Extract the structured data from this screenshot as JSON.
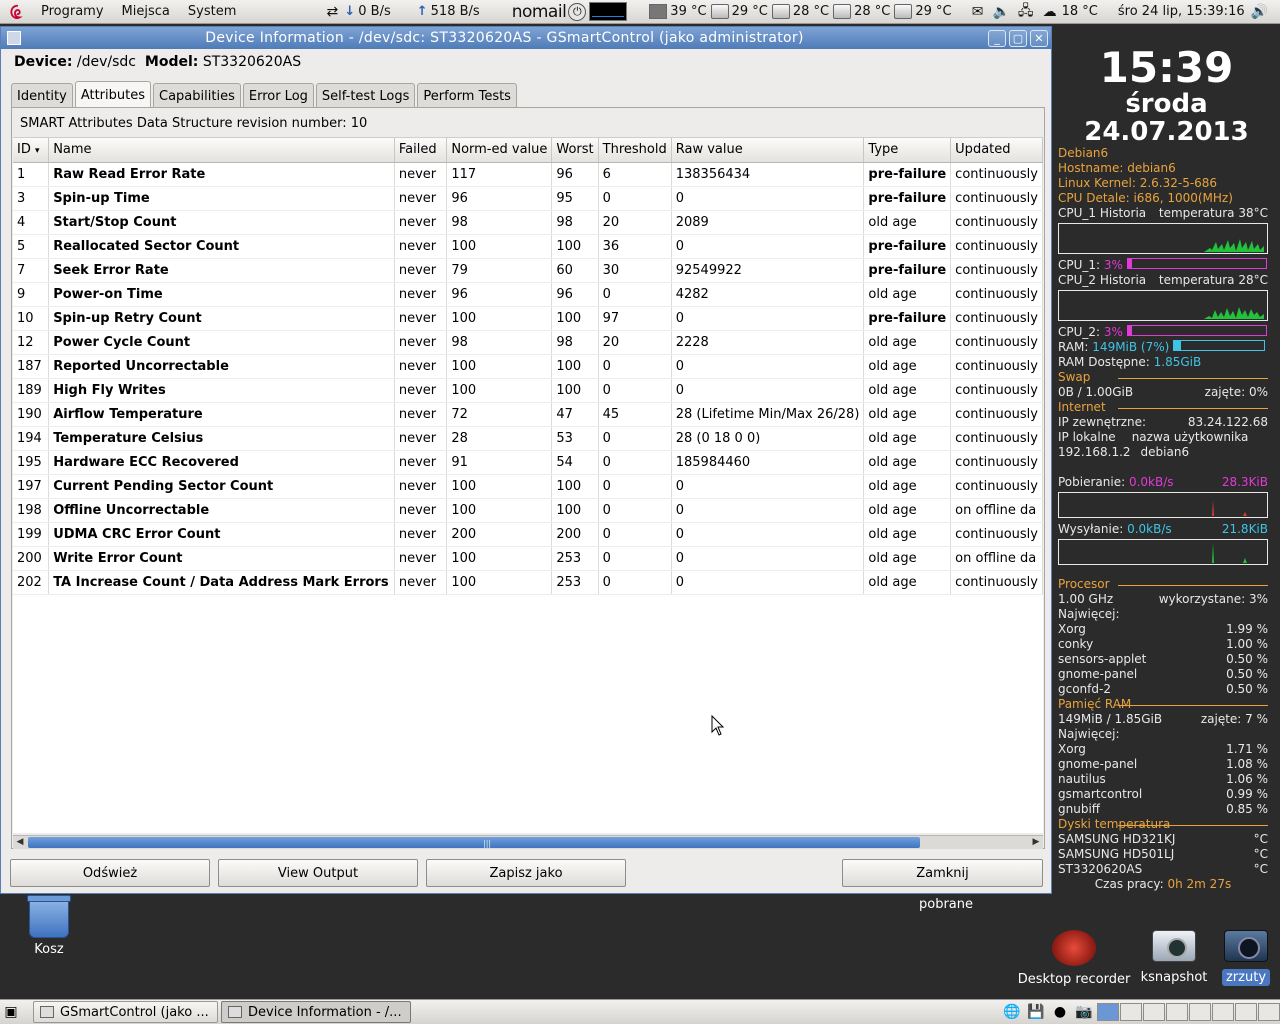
{
  "top_panel": {
    "menus": [
      "Programy",
      "Miejsca",
      "System"
    ],
    "net_down": "0 B/s",
    "net_up": "518 B/s",
    "nomail": "nomail",
    "temps": [
      "39 °C",
      "29 °C",
      "28 °C",
      "28 °C",
      "29 °C"
    ],
    "weather": "18 °C",
    "datetime": "śro 24 lip, 15:39:16"
  },
  "window": {
    "title": "Device Information - /dev/sdc: ST3320620AS - GSmartControl (jako administrator)",
    "device_label": "Device:",
    "device_value": "/dev/sdc",
    "model_label": "Model:",
    "model_value": "ST3320620AS",
    "tabs": [
      "Identity",
      "Attributes",
      "Capabilities",
      "Error Log",
      "Self-test Logs",
      "Perform Tests"
    ],
    "revision": "SMART Attributes Data Structure revision number: 10",
    "columns": [
      "ID",
      "Name",
      "Failed",
      "Norm-ed value",
      "Worst",
      "Threshold",
      "Raw value",
      "Type",
      "Updated"
    ],
    "rows": [
      [
        "1",
        "Raw Read Error Rate",
        "never",
        "117",
        "96",
        "6",
        "138356434",
        "pre-failure",
        "continuously"
      ],
      [
        "3",
        "Spin-up Time",
        "never",
        "96",
        "95",
        "0",
        "0",
        "pre-failure",
        "continuously"
      ],
      [
        "4",
        "Start/Stop Count",
        "never",
        "98",
        "98",
        "20",
        "2089",
        "old age",
        "continuously"
      ],
      [
        "5",
        "Reallocated Sector Count",
        "never",
        "100",
        "100",
        "36",
        "0",
        "pre-failure",
        "continuously"
      ],
      [
        "7",
        "Seek Error Rate",
        "never",
        "79",
        "60",
        "30",
        "92549922",
        "pre-failure",
        "continuously"
      ],
      [
        "9",
        "Power-on Time",
        "never",
        "96",
        "96",
        "0",
        "4282",
        "old age",
        "continuously"
      ],
      [
        "10",
        "Spin-up Retry Count",
        "never",
        "100",
        "100",
        "97",
        "0",
        "pre-failure",
        "continuously"
      ],
      [
        "12",
        "Power Cycle Count",
        "never",
        "98",
        "98",
        "20",
        "2228",
        "old age",
        "continuously"
      ],
      [
        "187",
        "Reported Uncorrectable",
        "never",
        "100",
        "100",
        "0",
        "0",
        "old age",
        "continuously"
      ],
      [
        "189",
        "High Fly Writes",
        "never",
        "100",
        "100",
        "0",
        "0",
        "old age",
        "continuously"
      ],
      [
        "190",
        "Airflow Temperature",
        "never",
        "72",
        "47",
        "45",
        "28 (Lifetime Min/Max 26/28)",
        "old age",
        "continuously"
      ],
      [
        "194",
        "Temperature Celsius",
        "never",
        "28",
        "53",
        "0",
        "28 (0 18 0 0)",
        "old age",
        "continuously"
      ],
      [
        "195",
        "Hardware ECC Recovered",
        "never",
        "91",
        "54",
        "0",
        "185984460",
        "old age",
        "continuously"
      ],
      [
        "197",
        "Current Pending Sector Count",
        "never",
        "100",
        "100",
        "0",
        "0",
        "old age",
        "continuously"
      ],
      [
        "198",
        "Offline Uncorrectable",
        "never",
        "100",
        "100",
        "0",
        "0",
        "old age",
        "on offline da"
      ],
      [
        "199",
        "UDMA CRC Error Count",
        "never",
        "200",
        "200",
        "0",
        "0",
        "old age",
        "continuously"
      ],
      [
        "200",
        "Write Error Count",
        "never",
        "100",
        "253",
        "0",
        "0",
        "old age",
        "on offline da"
      ],
      [
        "202",
        "TA Increase Count / Data Address Mark Errors",
        "never",
        "100",
        "253",
        "0",
        "0",
        "old age",
        "continuously"
      ]
    ],
    "buttons": {
      "refresh": "Odśwież",
      "view_output": "View Output",
      "save_as": "Zapisz jako",
      "close": "Zamknij"
    }
  },
  "desktop": {
    "trash": "Kosz",
    "pobrane": "pobrane",
    "desktop_recorder": "Desktop recorder",
    "ksnapshot": "ksnapshot",
    "zrzuty": "zrzuty"
  },
  "conky": {
    "time": "15:39",
    "day": "środa",
    "date": "24.07.2013",
    "distro": "Debian6",
    "hostname": "Hostname: debian6",
    "kernel": "Linux Kernel: 2.6.32-5-686",
    "cpu_details": "CPU Detale:  i686, 1000(MHz)",
    "cpu1_hist_label": "CPU_1 Historia",
    "cpu1_temp": "temperatura 38°C",
    "cpu1_label": "CPU_1:",
    "cpu1_value": "3%",
    "cpu1_fraction": 0.03,
    "cpu2_hist_label": "CPU_2 Historia",
    "cpu2_temp": "temperatura 28°C",
    "cpu2_label": "CPU_2:",
    "cpu2_value": "3%",
    "cpu2_fraction": 0.03,
    "ram_label": "RAM:",
    "ram_value": "149MiB (7%)",
    "ram_fraction": 0.07,
    "ram_avail_label": "RAM Dostępne:",
    "ram_avail_value": "1.85GiB",
    "swap_heading": "Swap",
    "swap_used": "0B   / 1.00GiB",
    "swap_taken": "zajęte: 0%",
    "internet_heading": "Internet",
    "ip_ext_label": "IP zewnętrzne:",
    "ip_ext_value": "83.24.122.68",
    "ip_local_label": "IP lokalne",
    "user_label": "nazwa użytkownika",
    "ip_local_value": "192.168.1.2",
    "user_value": "debian6",
    "down_label": "Pobieranie:",
    "down_value": "0.0kB/s",
    "down_total": "28.3KiB",
    "up_label": "Wysyłanie:",
    "up_value": "0.0kB/s",
    "up_total": "21.8KiB",
    "proc_heading": "Procesor",
    "proc_freq": "1.00 GHz",
    "proc_used": "wykorzystane: 3%",
    "most_label": "Najwięcej:",
    "cpu_procs": [
      [
        "Xorg",
        "1.99 %"
      ],
      [
        "conky",
        "1.00 %"
      ],
      [
        "sensors-applet",
        "0.50 %"
      ],
      [
        "gnome-panel",
        "0.50 %"
      ],
      [
        "gconfd-2",
        "0.50 %"
      ]
    ],
    "mem_heading": "Pamięć RAM",
    "mem_used": "149MiB / 1.85GiB",
    "mem_taken": "zajęte: 7 %",
    "mem_procs": [
      [
        "Xorg",
        "1.71 %"
      ],
      [
        "gnome-panel",
        "1.08 %"
      ],
      [
        "nautilus",
        "1.06 %"
      ],
      [
        "gsmartcontrol",
        "0.99 %"
      ],
      [
        "gnubiff",
        "0.85 %"
      ]
    ],
    "disk_heading": "Dyski temperatura",
    "disks": [
      [
        "SAMSUNG HD321KJ",
        "°C"
      ],
      [
        "SAMSUNG HD501LJ",
        "°C"
      ],
      [
        "ST3320620AS",
        "°C"
      ]
    ],
    "uptime_label": "Czas pracy:",
    "uptime_value": "0h 2m 27s"
  },
  "bottom_panel": {
    "task1": "GSmartControl (jako ...",
    "task2": "Device Information - /..."
  },
  "colors": {
    "conky_orange": "#e8a33d",
    "conky_magenta": "#e23ad8",
    "conky_cyan": "#3ec4e6",
    "titlebar_blue": "#5a85c0"
  }
}
